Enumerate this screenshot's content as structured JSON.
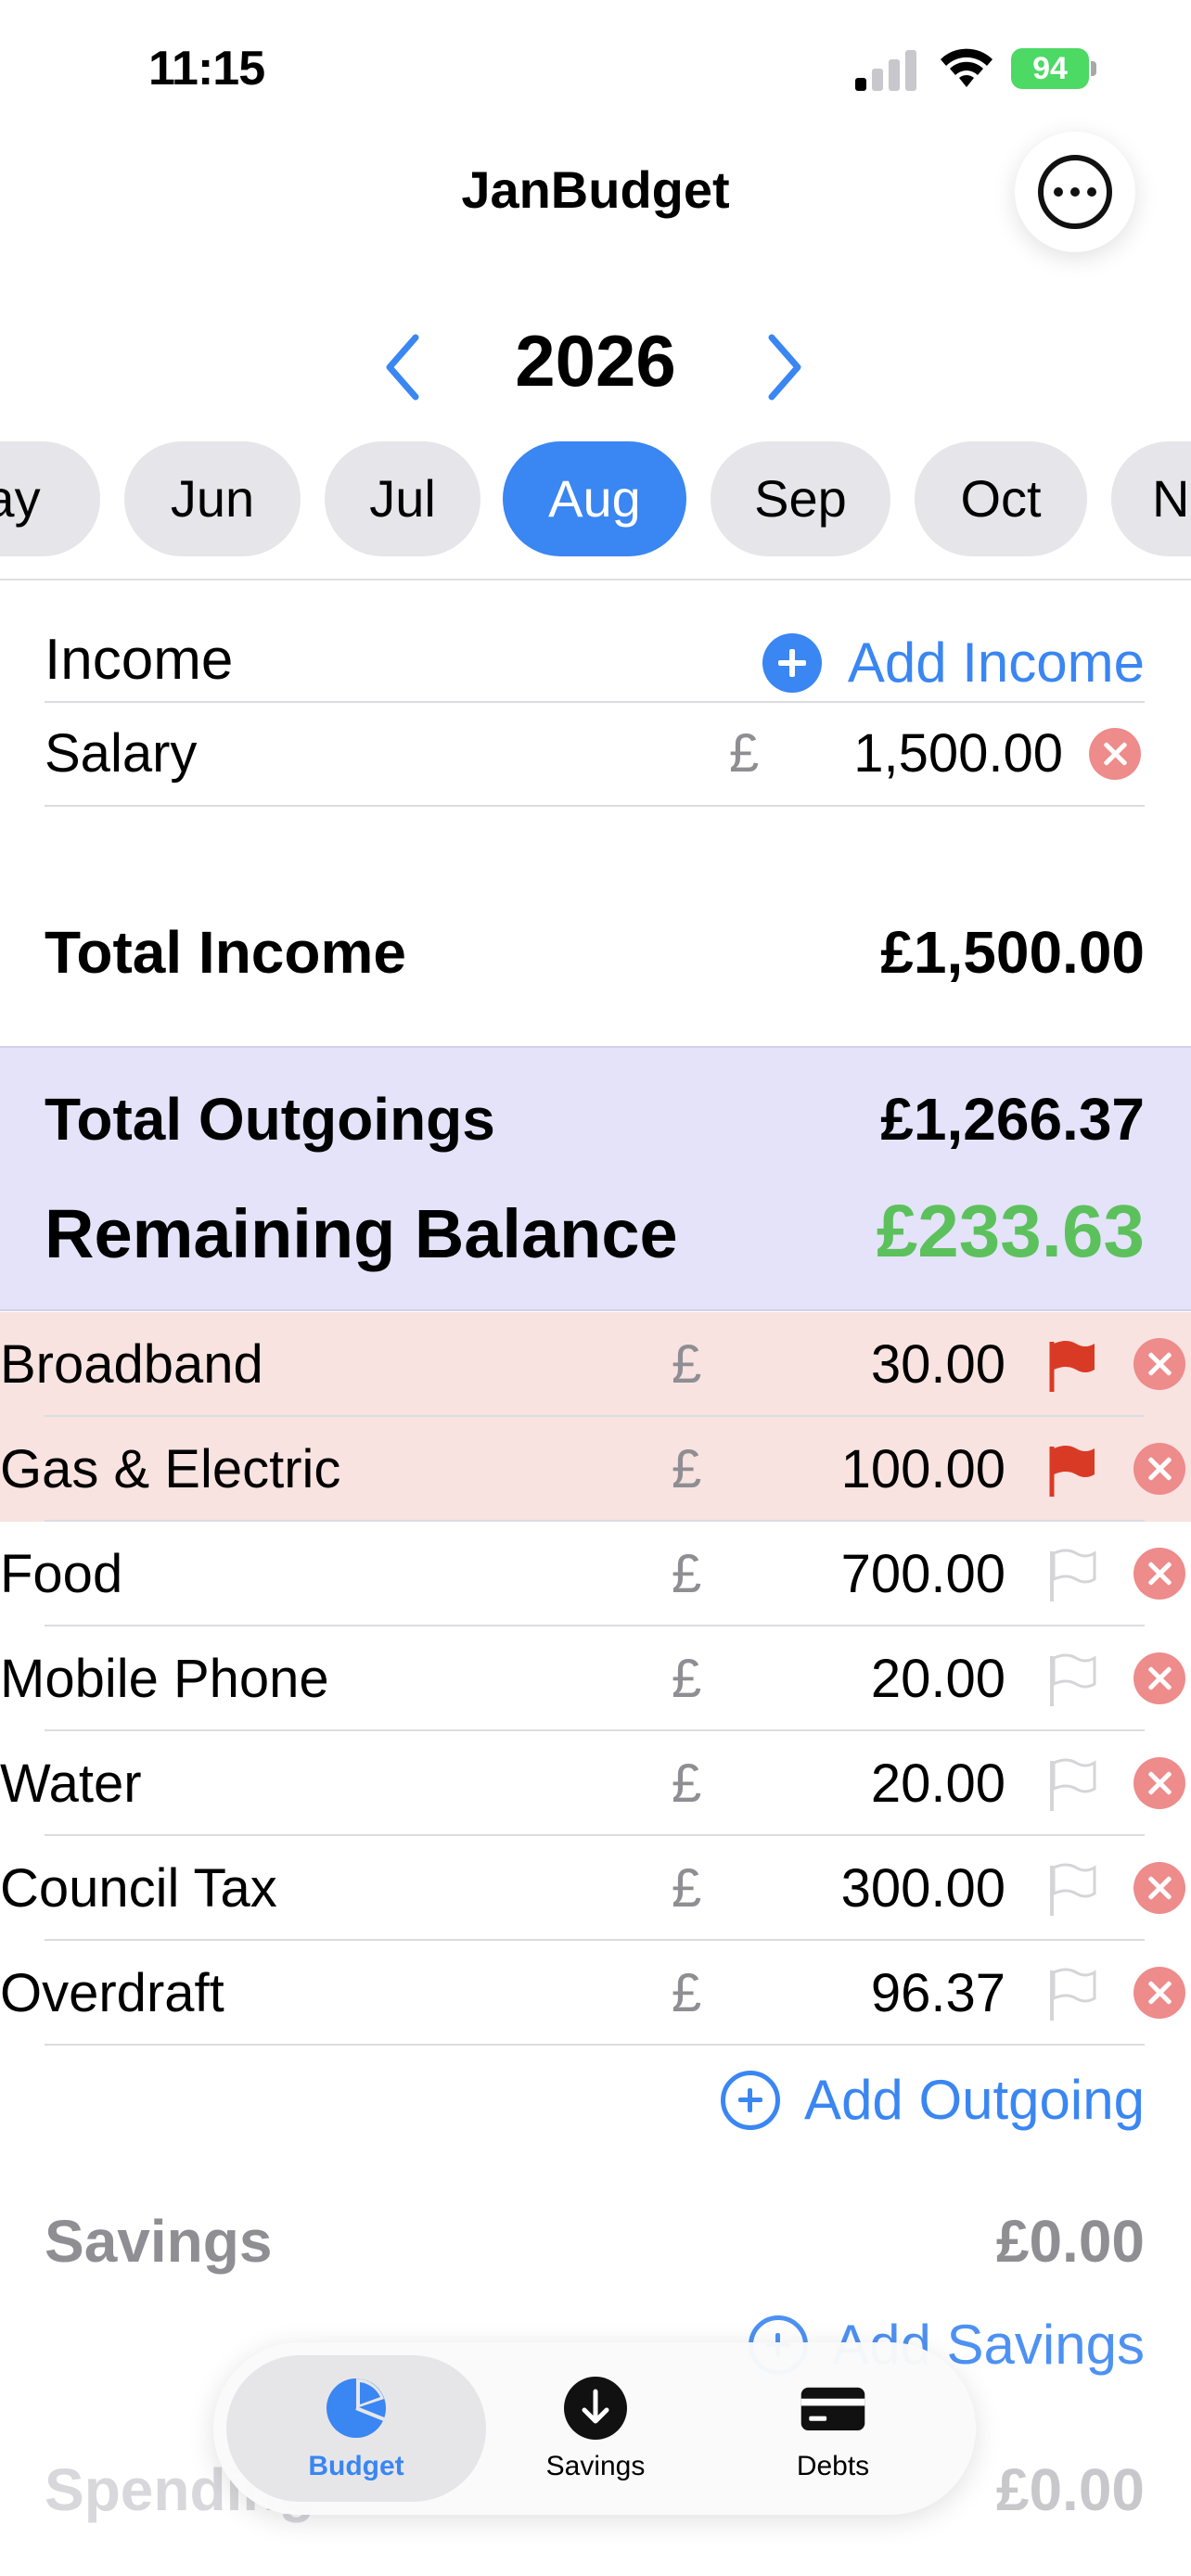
{
  "status_bar": {
    "time": "11:15",
    "battery": "94"
  },
  "nav": {
    "title": "JanBudget",
    "more_icon": "ellipsis-circle-icon"
  },
  "year": {
    "value": "2026"
  },
  "months": [
    "ay",
    "Jun",
    "Jul",
    "Aug",
    "Sep",
    "Oct",
    "N"
  ],
  "selected_month": "Aug",
  "income": {
    "heading": "Income",
    "add_label": "Add Income",
    "items": [
      {
        "label": "Salary",
        "currency": "£",
        "amount": "1,500.00"
      }
    ],
    "total_label": "Total Income",
    "total_value": "£1,500.00"
  },
  "summary": {
    "outgoings_label": "Total Outgoings",
    "outgoings_value": "£1,266.37",
    "balance_label": "Remaining Balance",
    "balance_value": "£233.63",
    "balance_color": "#5cc15c"
  },
  "outgoings": {
    "items": [
      {
        "label": "Broadband",
        "currency": "£",
        "amount": "30.00",
        "flagged": true
      },
      {
        "label": "Gas & Electric",
        "currency": "£",
        "amount": "100.00",
        "flagged": true
      },
      {
        "label": "Food",
        "currency": "£",
        "amount": "700.00",
        "flagged": false
      },
      {
        "label": "Mobile Phone",
        "currency": "£",
        "amount": "20.00",
        "flagged": false
      },
      {
        "label": "Water",
        "currency": "£",
        "amount": "20.00",
        "flagged": false
      },
      {
        "label": "Council Tax",
        "currency": "£",
        "amount": "300.00",
        "flagged": false
      },
      {
        "label": "Overdraft",
        "currency": "£",
        "amount": "96.37",
        "flagged": false
      }
    ],
    "add_label": "Add Outgoing"
  },
  "savings": {
    "label": "Savings",
    "value": "£0.00",
    "add_label": "Add Savings"
  },
  "spending": {
    "label": "Spending",
    "value": "£0.00"
  },
  "tabs": [
    {
      "label": "Budget",
      "icon": "pie-chart-icon",
      "active": true
    },
    {
      "label": "Savings",
      "icon": "arrow-down-circle-icon",
      "active": false
    },
    {
      "label": "Debts",
      "icon": "credit-card-icon",
      "active": false
    }
  ],
  "colors": {
    "accent": "#3a86f2",
    "flag_red": "#d93a25",
    "remove_red": "#ee8b8b",
    "summary_bg": "#e4e3f9",
    "flagged_row_bg": "#f8e3e0"
  }
}
